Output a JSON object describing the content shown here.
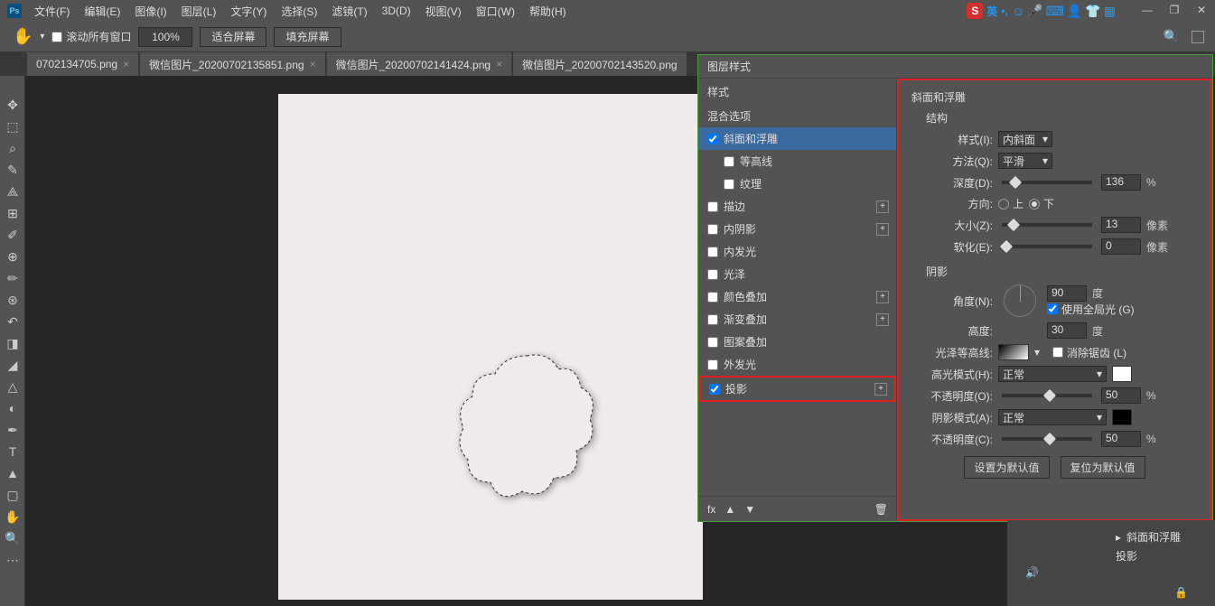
{
  "menubar": [
    "文件(F)",
    "编辑(E)",
    "图像(I)",
    "图层(L)",
    "文字(Y)",
    "选择(S)",
    "滤镜(T)",
    "3D(D)",
    "视图(V)",
    "窗口(W)",
    "帮助(H)"
  ],
  "ime": {
    "logo": "S",
    "lang": "英"
  },
  "options": {
    "scroll_all": "滚动所有窗口",
    "zoom": "100%",
    "fit": "适合屏幕",
    "fill": "填充屏幕"
  },
  "tabs": [
    "0702134705.png",
    "微信图片_20200702135851.png",
    "微信图片_20200702141424.png",
    "微信图片_20200702143520.png"
  ],
  "dialog": {
    "title": "图层样式",
    "style_hdr": "样式",
    "blend_opts": "混合选项",
    "items": [
      {
        "label": "斜面和浮雕",
        "checked": true,
        "selected": true
      },
      {
        "label": "等高线",
        "checked": false,
        "sub": true
      },
      {
        "label": "纹理",
        "checked": false,
        "sub": true
      },
      {
        "label": "描边",
        "checked": false,
        "add": true
      },
      {
        "label": "内阴影",
        "checked": false,
        "add": true
      },
      {
        "label": "内发光",
        "checked": false
      },
      {
        "label": "光泽",
        "checked": false
      },
      {
        "label": "颜色叠加",
        "checked": false,
        "add": true
      },
      {
        "label": "渐变叠加",
        "checked": false,
        "add": true
      },
      {
        "label": "图案叠加",
        "checked": false
      },
      {
        "label": "外发光",
        "checked": false
      },
      {
        "label": "投影",
        "checked": true,
        "add": true,
        "hl": true
      }
    ]
  },
  "bevel": {
    "title": "斜面和浮雕",
    "struct": "结构",
    "style_lbl": "样式(I):",
    "style_val": "内斜面",
    "tech_lbl": "方法(Q):",
    "tech_val": "平滑",
    "depth_lbl": "深度(D):",
    "depth_val": "136",
    "depth_unit": "%",
    "dir_lbl": "方向:",
    "up": "上",
    "down": "下",
    "size_lbl": "大小(Z):",
    "size_val": "13",
    "size_unit": "像素",
    "soft_lbl": "软化(E):",
    "soft_val": "0",
    "soft_unit": "像素",
    "shading": "阴影",
    "angle_lbl": "角度(N):",
    "angle_val": "90",
    "deg": "度",
    "global": "使用全局光 (G)",
    "alt_lbl": "高度:",
    "alt_val": "30",
    "gloss_lbl": "光泽等高线:",
    "anti": "消除锯齿 (L)",
    "hl_mode_lbl": "高光模式(H):",
    "hl_mode_val": "正常",
    "hl_op_lbl": "不透明度(O):",
    "hl_op_val": "50",
    "sh_mode_lbl": "阴影模式(A):",
    "sh_mode_val": "正常",
    "sh_op_lbl": "不透明度(C):",
    "sh_op_val": "50",
    "pct": "%",
    "default": "设置为默认值",
    "reset": "复位为默认值"
  },
  "fx_panel": {
    "bevel": "斜面和浮雕",
    "drop": "投影"
  }
}
